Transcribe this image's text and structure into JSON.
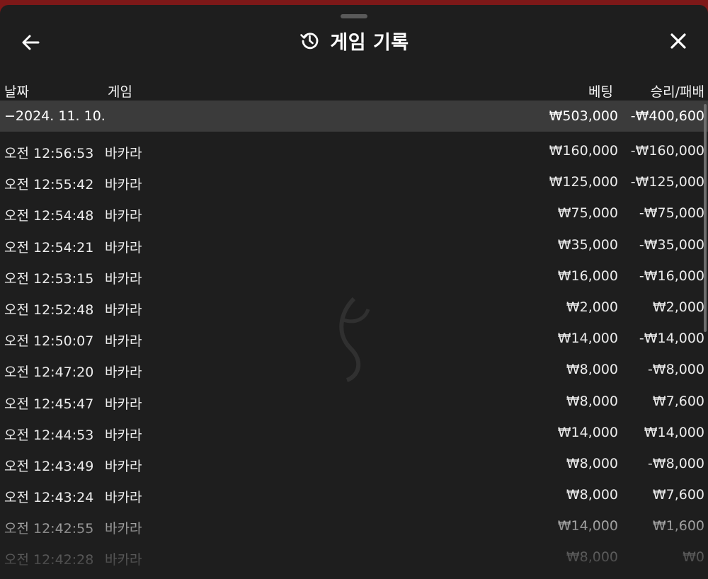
{
  "header": {
    "title": "게임 기록",
    "back_icon": "arrow-left-icon",
    "history_icon": "history-icon",
    "close_icon": "close-icon"
  },
  "columns": {
    "date": "날짜",
    "game": "게임",
    "bet": "베팅",
    "result": "승리/패배"
  },
  "group": {
    "date": "−2024. 11. 10.",
    "bet": "₩503,000",
    "result": "-₩400,600"
  },
  "rows": [
    {
      "time": "오전 12:56:53",
      "game": "바카라",
      "bet": "₩160,000",
      "result": "-₩160,000"
    },
    {
      "time": "오전 12:55:42",
      "game": "바카라",
      "bet": "₩125,000",
      "result": "-₩125,000"
    },
    {
      "time": "오전 12:54:48",
      "game": "바카라",
      "bet": "₩75,000",
      "result": "-₩75,000"
    },
    {
      "time": "오전 12:54:21",
      "game": "바카라",
      "bet": "₩35,000",
      "result": "-₩35,000"
    },
    {
      "time": "오전 12:53:15",
      "game": "바카라",
      "bet": "₩16,000",
      "result": "-₩16,000"
    },
    {
      "time": "오전 12:52:48",
      "game": "바카라",
      "bet": "₩2,000",
      "result": "₩2,000"
    },
    {
      "time": "오전 12:50:07",
      "game": "바카라",
      "bet": "₩14,000",
      "result": "-₩14,000"
    },
    {
      "time": "오전 12:47:20",
      "game": "바카라",
      "bet": "₩8,000",
      "result": "-₩8,000"
    },
    {
      "time": "오전 12:45:47",
      "game": "바카라",
      "bet": "₩8,000",
      "result": "₩7,600"
    },
    {
      "time": "오전 12:44:53",
      "game": "바카라",
      "bet": "₩14,000",
      "result": "₩14,000"
    },
    {
      "time": "오전 12:43:49",
      "game": "바카라",
      "bet": "₩8,000",
      "result": "-₩8,000"
    },
    {
      "time": "오전 12:43:24",
      "game": "바카라",
      "bet": "₩8,000",
      "result": "₩7,600"
    },
    {
      "time": "오전 12:42:55",
      "game": "바카라",
      "bet": "₩14,000",
      "result": "₩1,600"
    },
    {
      "time": "오전 12:42:28",
      "game": "바카라",
      "bet": "₩8,000",
      "result": "₩0"
    }
  ],
  "colors": {
    "background": "#1e1e1e",
    "group_row": "#3b3b3b",
    "outer": "#7d1818",
    "text": "#f0f0f0"
  }
}
